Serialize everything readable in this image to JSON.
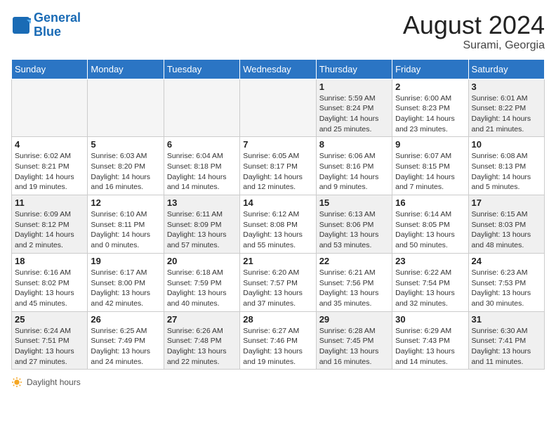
{
  "header": {
    "logo_line1": "General",
    "logo_line2": "Blue",
    "month_year": "August 2024",
    "location": "Surami, Georgia"
  },
  "days_of_week": [
    "Sunday",
    "Monday",
    "Tuesday",
    "Wednesday",
    "Thursday",
    "Friday",
    "Saturday"
  ],
  "weeks": [
    [
      {
        "day": "",
        "info": ""
      },
      {
        "day": "",
        "info": ""
      },
      {
        "day": "",
        "info": ""
      },
      {
        "day": "",
        "info": ""
      },
      {
        "day": "1",
        "info": "Sunrise: 5:59 AM\nSunset: 8:24 PM\nDaylight: 14 hours and 25 minutes."
      },
      {
        "day": "2",
        "info": "Sunrise: 6:00 AM\nSunset: 8:23 PM\nDaylight: 14 hours and 23 minutes."
      },
      {
        "day": "3",
        "info": "Sunrise: 6:01 AM\nSunset: 8:22 PM\nDaylight: 14 hours and 21 minutes."
      }
    ],
    [
      {
        "day": "4",
        "info": "Sunrise: 6:02 AM\nSunset: 8:21 PM\nDaylight: 14 hours and 19 minutes."
      },
      {
        "day": "5",
        "info": "Sunrise: 6:03 AM\nSunset: 8:20 PM\nDaylight: 14 hours and 16 minutes."
      },
      {
        "day": "6",
        "info": "Sunrise: 6:04 AM\nSunset: 8:18 PM\nDaylight: 14 hours and 14 minutes."
      },
      {
        "day": "7",
        "info": "Sunrise: 6:05 AM\nSunset: 8:17 PM\nDaylight: 14 hours and 12 minutes."
      },
      {
        "day": "8",
        "info": "Sunrise: 6:06 AM\nSunset: 8:16 PM\nDaylight: 14 hours and 9 minutes."
      },
      {
        "day": "9",
        "info": "Sunrise: 6:07 AM\nSunset: 8:15 PM\nDaylight: 14 hours and 7 minutes."
      },
      {
        "day": "10",
        "info": "Sunrise: 6:08 AM\nSunset: 8:13 PM\nDaylight: 14 hours and 5 minutes."
      }
    ],
    [
      {
        "day": "11",
        "info": "Sunrise: 6:09 AM\nSunset: 8:12 PM\nDaylight: 14 hours and 2 minutes."
      },
      {
        "day": "12",
        "info": "Sunrise: 6:10 AM\nSunset: 8:11 PM\nDaylight: 14 hours and 0 minutes."
      },
      {
        "day": "13",
        "info": "Sunrise: 6:11 AM\nSunset: 8:09 PM\nDaylight: 13 hours and 57 minutes."
      },
      {
        "day": "14",
        "info": "Sunrise: 6:12 AM\nSunset: 8:08 PM\nDaylight: 13 hours and 55 minutes."
      },
      {
        "day": "15",
        "info": "Sunrise: 6:13 AM\nSunset: 8:06 PM\nDaylight: 13 hours and 53 minutes."
      },
      {
        "day": "16",
        "info": "Sunrise: 6:14 AM\nSunset: 8:05 PM\nDaylight: 13 hours and 50 minutes."
      },
      {
        "day": "17",
        "info": "Sunrise: 6:15 AM\nSunset: 8:03 PM\nDaylight: 13 hours and 48 minutes."
      }
    ],
    [
      {
        "day": "18",
        "info": "Sunrise: 6:16 AM\nSunset: 8:02 PM\nDaylight: 13 hours and 45 minutes."
      },
      {
        "day": "19",
        "info": "Sunrise: 6:17 AM\nSunset: 8:00 PM\nDaylight: 13 hours and 42 minutes."
      },
      {
        "day": "20",
        "info": "Sunrise: 6:18 AM\nSunset: 7:59 PM\nDaylight: 13 hours and 40 minutes."
      },
      {
        "day": "21",
        "info": "Sunrise: 6:20 AM\nSunset: 7:57 PM\nDaylight: 13 hours and 37 minutes."
      },
      {
        "day": "22",
        "info": "Sunrise: 6:21 AM\nSunset: 7:56 PM\nDaylight: 13 hours and 35 minutes."
      },
      {
        "day": "23",
        "info": "Sunrise: 6:22 AM\nSunset: 7:54 PM\nDaylight: 13 hours and 32 minutes."
      },
      {
        "day": "24",
        "info": "Sunrise: 6:23 AM\nSunset: 7:53 PM\nDaylight: 13 hours and 30 minutes."
      }
    ],
    [
      {
        "day": "25",
        "info": "Sunrise: 6:24 AM\nSunset: 7:51 PM\nDaylight: 13 hours and 27 minutes."
      },
      {
        "day": "26",
        "info": "Sunrise: 6:25 AM\nSunset: 7:49 PM\nDaylight: 13 hours and 24 minutes."
      },
      {
        "day": "27",
        "info": "Sunrise: 6:26 AM\nSunset: 7:48 PM\nDaylight: 13 hours and 22 minutes."
      },
      {
        "day": "28",
        "info": "Sunrise: 6:27 AM\nSunset: 7:46 PM\nDaylight: 13 hours and 19 minutes."
      },
      {
        "day": "29",
        "info": "Sunrise: 6:28 AM\nSunset: 7:45 PM\nDaylight: 13 hours and 16 minutes."
      },
      {
        "day": "30",
        "info": "Sunrise: 6:29 AM\nSunset: 7:43 PM\nDaylight: 13 hours and 14 minutes."
      },
      {
        "day": "31",
        "info": "Sunrise: 6:30 AM\nSunset: 7:41 PM\nDaylight: 13 hours and 11 minutes."
      }
    ]
  ],
  "footer": {
    "daylight_label": "Daylight hours"
  }
}
